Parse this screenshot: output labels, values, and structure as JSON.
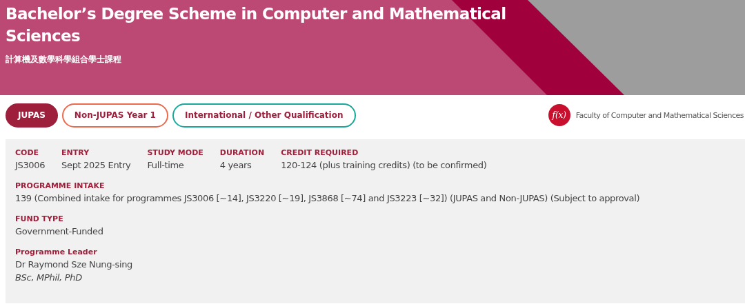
{
  "header": {
    "title": "Bachelor’s Degree Scheme in Computer and Mathematical Sciences",
    "subtitle": "計算機及數學科學組合學士課程"
  },
  "tabs": [
    {
      "label": "JUPAS",
      "selected": true,
      "color": "#9e1f3c"
    },
    {
      "label": "Non-JUPAS Year 1",
      "selected": false,
      "color": "#ee6a4d"
    },
    {
      "label": "International / Other Qualification",
      "selected": false,
      "color": "#17a99a"
    }
  ],
  "faculty": {
    "logo_mark": "f(x)",
    "name": "Faculty of Computer and Mathematical Sciences"
  },
  "details": [
    [
      {
        "label": "CODE",
        "value": "JS3006"
      },
      {
        "label": "ENTRY",
        "value": "Sept 2025 Entry"
      },
      {
        "label": "STUDY MODE",
        "value": "Full-time"
      },
      {
        "label": "DURATION",
        "value": "4 years"
      },
      {
        "label": "CREDIT REQUIRED",
        "value": "120-124 (plus training credits) (to be confirmed)"
      }
    ],
    [
      {
        "label": "PROGRAMME INTAKE",
        "value": "139 (Combined intake for programmes JS3006 [~14], JS3220 [~19], JS3868 [~74] and JS3223 [~32]) (JUPAS and Non-JUPAS) (Subject to approval)"
      }
    ],
    [
      {
        "label": "FUND TYPE",
        "value": "Government-Funded"
      }
    ],
    [
      {
        "label": "Programme Leader",
        "value": "Dr Raymond Sze Nung-sing",
        "note": "BSc, MPhil, PhD"
      }
    ]
  ]
}
